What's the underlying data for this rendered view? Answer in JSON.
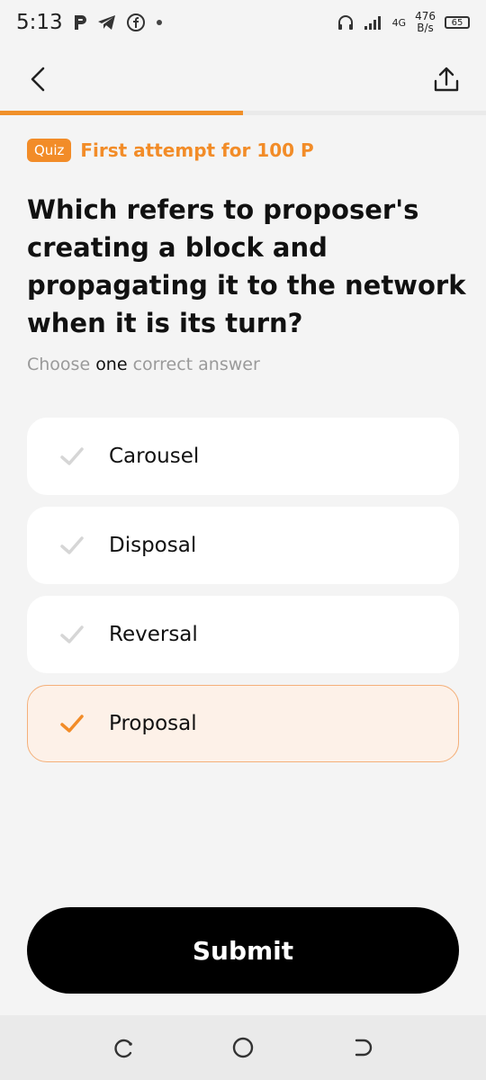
{
  "status_bar": {
    "time": "5:13",
    "net_badge": "4G",
    "speed_value": "476",
    "speed_unit": "B/s",
    "battery": "65"
  },
  "progress": {
    "fraction": 0.5
  },
  "quiz": {
    "badge": "Quiz",
    "attempt": "First attempt for 100 P"
  },
  "question": {
    "text": "Which refers to proposer's creating a block and propagating it to the network when it is its turn?",
    "hint_pre": "Choose ",
    "hint_strong": "one",
    "hint_post": " correct answer"
  },
  "options": [
    {
      "label": "Carousel",
      "selected": false
    },
    {
      "label": "Disposal",
      "selected": false
    },
    {
      "label": "Reversal",
      "selected": false
    },
    {
      "label": "Proposal",
      "selected": true
    }
  ],
  "submit": {
    "label": "Submit"
  },
  "colors": {
    "accent": "#f28c28",
    "selected_bg": "#fdf1e8",
    "unchecked": "#d6d6d6",
    "submit_bg": "#000000"
  },
  "icons": {
    "back": "chevron-left-icon",
    "share": "share-upload-icon",
    "check": "checkmark-icon",
    "nav_back": "nav-back-icon",
    "nav_home": "nav-home-icon",
    "nav_recents": "nav-recents-icon"
  }
}
